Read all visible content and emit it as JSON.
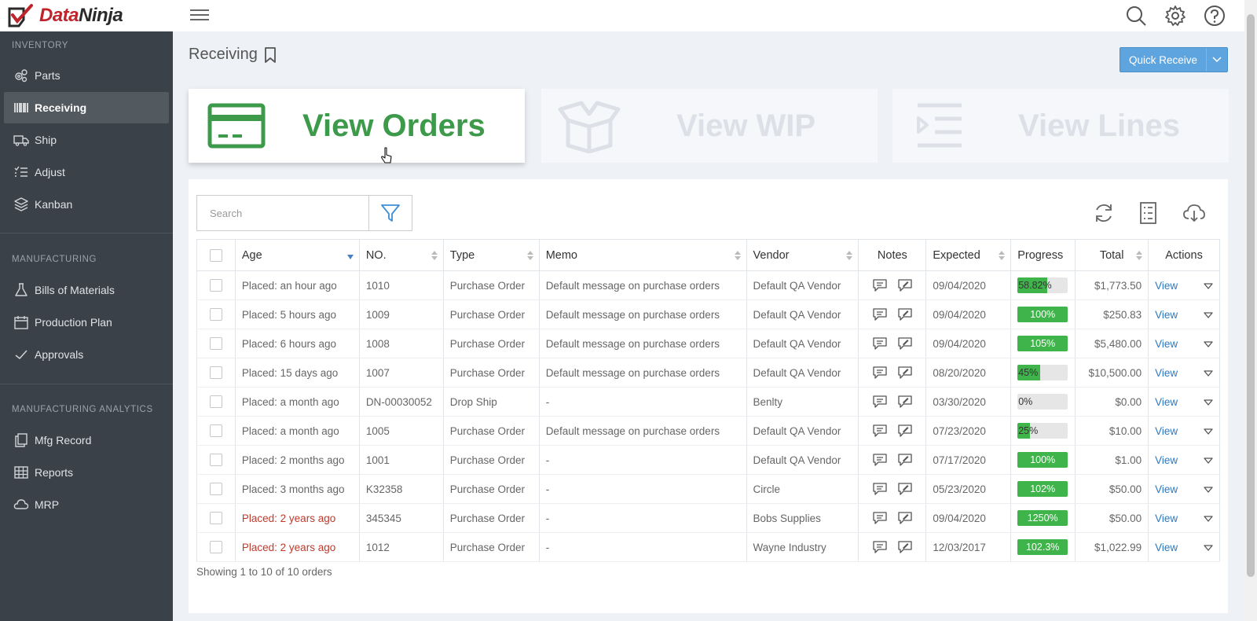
{
  "brand": {
    "part1": "Data",
    "part2": "Ninja"
  },
  "sidebar": {
    "sections": [
      {
        "label": "INVENTORY",
        "items": [
          {
            "label": "Parts",
            "icon": "gears-icon"
          },
          {
            "label": "Receiving",
            "icon": "barcode-icon",
            "active": true
          },
          {
            "label": "Ship",
            "icon": "truck-icon"
          },
          {
            "label": "Adjust",
            "icon": "list-adjust-icon"
          },
          {
            "label": "Kanban",
            "icon": "layers-icon"
          }
        ]
      },
      {
        "label": "MANUFACTURING",
        "items": [
          {
            "label": "Bills of Materials",
            "icon": "flask-icon"
          },
          {
            "label": "Production Plan",
            "icon": "calendar-icon"
          },
          {
            "label": "Approvals",
            "icon": "check-icon"
          }
        ]
      },
      {
        "label": "MANUFACTURING ANALYTICS",
        "items": [
          {
            "label": "Mfg Record",
            "icon": "copy-icon"
          },
          {
            "label": "Reports",
            "icon": "table-icon"
          },
          {
            "label": "MRP",
            "icon": "cloud-icon"
          }
        ]
      }
    ]
  },
  "header": {
    "title": "Receiving",
    "quick_receive": "Quick Receive"
  },
  "cards": [
    {
      "label": "View Orders",
      "icon": "credit-card-icon",
      "active": true
    },
    {
      "label": "View WIP",
      "icon": "box-icon",
      "active": false
    },
    {
      "label": "View Lines",
      "icon": "indent-lines-icon",
      "active": false
    }
  ],
  "search": {
    "placeholder": "Search"
  },
  "table": {
    "columns": [
      "Age",
      "NO.",
      "Type",
      "Memo",
      "Vendor",
      "Notes",
      "Expected",
      "Progress",
      "Total",
      "Actions"
    ],
    "view_label": "View",
    "rows": [
      {
        "age": "Placed: an hour ago",
        "no": "1010",
        "type": "Purchase Order",
        "memo": "Default message on purchase orders",
        "vendor": "Default QA Vendor",
        "expected": "09/04/2020",
        "progress_label": "58.82%",
        "progress": 0.5882,
        "total": "$1,773.50",
        "overdue": false
      },
      {
        "age": "Placed: 5 hours ago",
        "no": "1009",
        "type": "Purchase Order",
        "memo": "Default message on purchase orders",
        "vendor": "Default QA Vendor",
        "expected": "09/04/2020",
        "progress_label": "100%",
        "progress": 1.0,
        "total": "$250.83",
        "overdue": false
      },
      {
        "age": "Placed: 6 hours ago",
        "no": "1008",
        "type": "Purchase Order",
        "memo": "Default message on purchase orders",
        "vendor": "Default QA Vendor",
        "expected": "09/04/2020",
        "progress_label": "105%",
        "progress": 1.05,
        "total": "$5,480.00",
        "overdue": false
      },
      {
        "age": "Placed: 15 days ago",
        "no": "1007",
        "type": "Purchase Order",
        "memo": "Default message on purchase orders",
        "vendor": "Default QA Vendor",
        "expected": "08/20/2020",
        "progress_label": "45%",
        "progress": 0.45,
        "total": "$10,500.00",
        "overdue": false
      },
      {
        "age": "Placed: a month ago",
        "no": "DN-00030052",
        "type": "Drop Ship",
        "memo": "-",
        "vendor": "Benlty",
        "expected": "03/30/2020",
        "progress_label": "0%",
        "progress": 0.0,
        "total": "$0.00",
        "overdue": false
      },
      {
        "age": "Placed: a month ago",
        "no": "1005",
        "type": "Purchase Order",
        "memo": "Default message on purchase orders",
        "vendor": "Default QA Vendor",
        "expected": "07/23/2020",
        "progress_label": "25%",
        "progress": 0.25,
        "total": "$10.00",
        "overdue": false
      },
      {
        "age": "Placed: 2 months ago",
        "no": "1001",
        "type": "Purchase Order",
        "memo": "-",
        "vendor": "Default QA Vendor",
        "expected": "07/17/2020",
        "progress_label": "100%",
        "progress": 1.0,
        "total": "$1.00",
        "overdue": false
      },
      {
        "age": "Placed: 3 months ago",
        "no": "K32358",
        "type": "Purchase Order",
        "memo": "-",
        "vendor": "Circle",
        "expected": "05/23/2020",
        "progress_label": "102%",
        "progress": 1.02,
        "total": "$50.00",
        "overdue": false
      },
      {
        "age": "Placed: 2 years ago",
        "no": "345345",
        "type": "Purchase Order",
        "memo": "-",
        "vendor": "Bobs Supplies",
        "expected": "09/04/2020",
        "progress_label": "1250%",
        "progress": 12.5,
        "total": "$50.00",
        "overdue": true
      },
      {
        "age": "Placed: 2 years ago",
        "no": "1012",
        "type": "Purchase Order",
        "memo": "-",
        "vendor": "Wayne Industry",
        "expected": "12/03/2017",
        "progress_label": "102.3%",
        "progress": 1.023,
        "total": "$1,022.99",
        "overdue": true
      }
    ],
    "footer": "Showing 1 to 10 of 10 orders"
  },
  "colors": {
    "sidebar_bg": "#3a4148",
    "accent_green": "#3c9a4a",
    "progress_green": "#3fb44b",
    "link_blue": "#2a7ac4",
    "button_blue": "#5ea5e0",
    "overdue_red": "#c0392b"
  }
}
